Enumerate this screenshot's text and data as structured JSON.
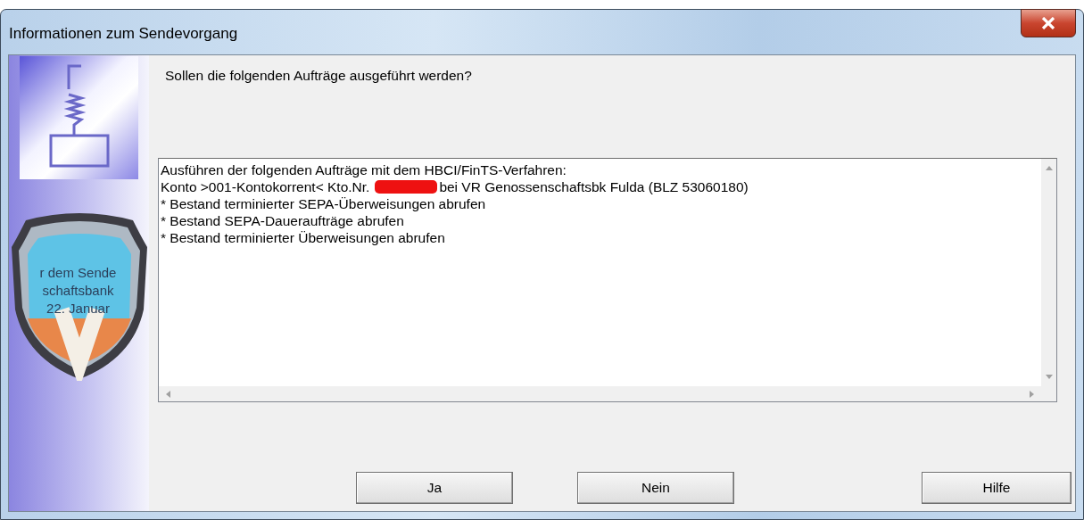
{
  "window": {
    "title": "Informationen zum Sendevorgang"
  },
  "banner": {
    "lines": [
      "r dem Sende",
      "schaftsbank",
      "22. Januar"
    ]
  },
  "question": "Sollen die folgenden Aufträge ausgeführt werden?",
  "details": {
    "lines": [
      {
        "kind": "text",
        "text": "Ausführen der folgenden Aufträge mit dem HBCI/FinTS-Verfahren:"
      },
      {
        "kind": "redacted",
        "before": "Konto >001-Kontokorrent< Kto.Nr.",
        "after": "bei VR Genossenschaftsbk Fulda (BLZ 53060180)"
      },
      {
        "kind": "text",
        "text": "* Bestand terminierter SEPA-Überweisungen abrufen"
      },
      {
        "kind": "text",
        "text": "* Bestand SEPA-Daueraufträge abrufen"
      },
      {
        "kind": "text",
        "text": "* Bestand terminierter Überweisungen abrufen"
      }
    ]
  },
  "buttons": [
    {
      "label": "Ja",
      "kind": "main"
    },
    {
      "label": "Nein",
      "kind": "main"
    },
    {
      "label": "Hilfe",
      "kind": "help"
    }
  ]
}
